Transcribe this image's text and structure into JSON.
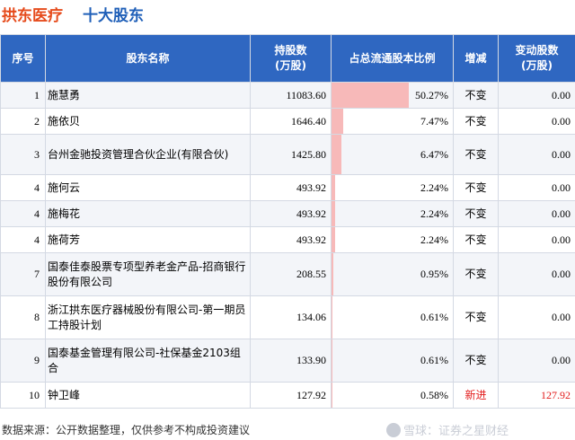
{
  "header": {
    "company": "拱东医疗",
    "subtitle": "十大股东"
  },
  "table": {
    "columns": {
      "rank": "序号",
      "name": "股东名称",
      "shares": "持股数\n(万股)",
      "ratio": "占总流通股本比例",
      "change": "增减",
      "delta": "变动股数\n(万股)"
    },
    "rows": [
      {
        "rank": "1",
        "name": "施慧勇",
        "shares": "11083.60",
        "ratio": "50.27%",
        "ratio_value": 50.27,
        "change": "不变",
        "delta": "0.00"
      },
      {
        "rank": "2",
        "name": "施依贝",
        "shares": "1646.40",
        "ratio": "7.47%",
        "ratio_value": 7.47,
        "change": "不变",
        "delta": "0.00"
      },
      {
        "rank": "3",
        "name": "台州金驰投资管理合伙企业(有限合伙)",
        "shares": "1425.80",
        "ratio": "6.47%",
        "ratio_value": 6.47,
        "change": "不变",
        "delta": "0.00"
      },
      {
        "rank": "4",
        "name": "施何云",
        "shares": "493.92",
        "ratio": "2.24%",
        "ratio_value": 2.24,
        "change": "不变",
        "delta": "0.00"
      },
      {
        "rank": "4",
        "name": "施梅花",
        "shares": "493.92",
        "ratio": "2.24%",
        "ratio_value": 2.24,
        "change": "不变",
        "delta": "0.00"
      },
      {
        "rank": "4",
        "name": "施荷芳",
        "shares": "493.92",
        "ratio": "2.24%",
        "ratio_value": 2.24,
        "change": "不变",
        "delta": "0.00"
      },
      {
        "rank": "7",
        "name": "国泰佳泰股票专项型养老金产品-招商银行股份有限公司",
        "shares": "208.55",
        "ratio": "0.95%",
        "ratio_value": 0.95,
        "change": "不变",
        "delta": "0.00"
      },
      {
        "rank": "8",
        "name": "浙江拱东医疗器械股份有限公司-第一期员工持股计划",
        "shares": "134.06",
        "ratio": "0.61%",
        "ratio_value": 0.61,
        "change": "不变",
        "delta": "0.00"
      },
      {
        "rank": "9",
        "name": "国泰基金管理有限公司-社保基金2103组合",
        "shares": "133.90",
        "ratio": "0.61%",
        "ratio_value": 0.61,
        "change": "不变",
        "delta": "0.00"
      },
      {
        "rank": "10",
        "name": "钟卫峰",
        "shares": "127.92",
        "ratio": "0.58%",
        "ratio_value": 0.58,
        "change": "新进",
        "delta": "127.92"
      }
    ]
  },
  "footer": {
    "source": "数据来源：公开数据整理，仅供参考不构成投资建议",
    "brand": "雪球：证券之星财经"
  },
  "colors": {
    "header_bg": "#2f67c1",
    "company_title": "#e64b1c",
    "subtitle": "#1f5fb8",
    "ratio_bar": "#f7b9b9",
    "new_entry": "#e21a1a"
  }
}
